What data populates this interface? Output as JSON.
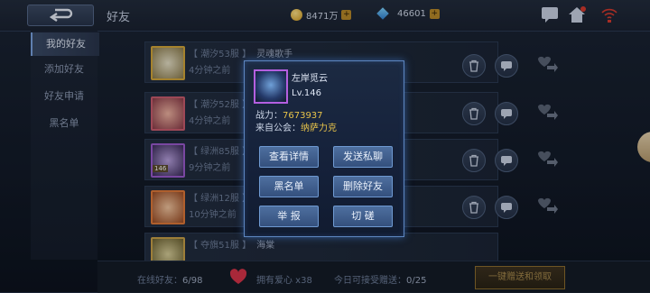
{
  "header": {
    "title": "好友",
    "gold": "8471万",
    "diamonds": "46601",
    "plus": "+"
  },
  "sidebar": {
    "items": [
      "我的好友",
      "添加好友",
      "好友申请",
      "黑名单"
    ]
  },
  "friends": [
    {
      "server": "【 潮汐53服 】",
      "name": "灵魂歌手",
      "time": "4分钟之前",
      "frame": "#d4a73a",
      "badge": ""
    },
    {
      "server": "【 潮汐52服 】",
      "name": "",
      "time": "4分钟之前",
      "frame": "#c95d6f",
      "badge": ""
    },
    {
      "server": "【 绿洲85服 】",
      "name": "",
      "time": "9分钟之前",
      "frame": "#9b5ccf",
      "badge": "146"
    },
    {
      "server": "【 绿洲12服 】",
      "name": "",
      "time": "10分钟之前",
      "frame": "#e07a3a",
      "badge": ""
    },
    {
      "server": "【 夺旗51服 】",
      "name": "海棠",
      "time": "",
      "frame": "#c9a24a",
      "badge": ""
    }
  ],
  "bottom": {
    "online_label": "在线好友：",
    "online_value": "6/98",
    "love_label": "拥有爱心 x38",
    "gift_label": "今日可接受赠送：",
    "gift_value": "0/25",
    "onekey": "一键赠送和领取"
  },
  "popup": {
    "name": "左岸觅云",
    "level": "Lv.146",
    "power_label": "战力：",
    "power_value": "7673937",
    "guild_label": "来自公会：",
    "guild_value": "纳萨力克",
    "buttons": {
      "view": "查看详情",
      "message": "发送私聊",
      "blacklist": "黑名单",
      "delete": "删除好友",
      "report": "举 报",
      "duel": "切 磋"
    }
  },
  "colors": {
    "accent": "#5d86c0",
    "gold_text": "#e8c44a",
    "popup_avatar_frame": "#b45fe0"
  }
}
